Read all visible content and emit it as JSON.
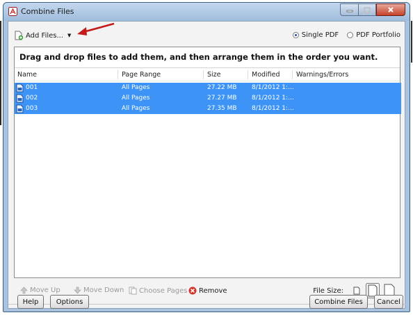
{
  "window": {
    "title": "Combine Files"
  },
  "toolbar_top": {
    "add_files_label": "Add Files...",
    "output_options": [
      {
        "label": "Single PDF",
        "selected": true
      },
      {
        "label": "PDF Portfolio",
        "selected": false
      }
    ]
  },
  "instruction": "Drag and drop files to add them, and then arrange them in the order you want.",
  "columns": [
    "Name",
    "Page Range",
    "Size",
    "Modified",
    "Warnings/Errors"
  ],
  "files": [
    {
      "name": "001",
      "page_range": "All Pages",
      "size": "27.22 MB",
      "modified": "8/1/2012 1:...",
      "warnings": ""
    },
    {
      "name": "002",
      "page_range": "All Pages",
      "size": "27.27 MB",
      "modified": "8/1/2012 1:...",
      "warnings": ""
    },
    {
      "name": "003",
      "page_range": "All Pages",
      "size": "27.35 MB",
      "modified": "8/1/2012 1:...",
      "warnings": ""
    }
  ],
  "actions": {
    "move_up": "Move Up",
    "move_down": "Move Down",
    "choose_pages": "Choose Pages",
    "remove": "Remove",
    "file_size_label": "File Size:"
  },
  "footer": {
    "help": "Help",
    "options": "Options",
    "combine": "Combine Files",
    "cancel": "Cancel"
  },
  "colors": {
    "selection": "#3d94f6",
    "annotation_arrow": "#c41a1a",
    "remove_icon": "#d0362c"
  }
}
